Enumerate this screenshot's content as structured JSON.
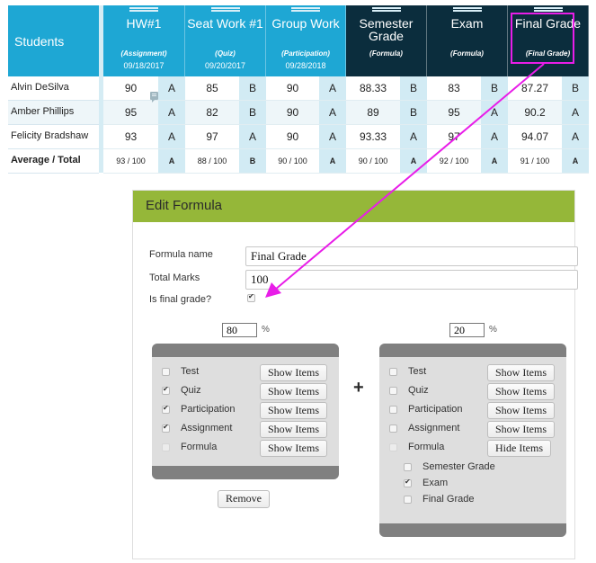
{
  "gradebook": {
    "students_header": "Students",
    "columns": [
      {
        "title": "HW#1",
        "category": "(Assignment)",
        "date": "09/18/2017"
      },
      {
        "title": "Seat Work #1",
        "category": "(Quiz)",
        "date": "09/20/2017"
      },
      {
        "title": "Group Work",
        "category": "(Participation)",
        "date": "09/28/2018"
      },
      {
        "title": "Semester Grade",
        "category": "(Formula)",
        "date": ""
      },
      {
        "title": "Exam",
        "category": "(Formula)",
        "date": ""
      },
      {
        "title": "Final Grade",
        "category": "(Final Grade)",
        "date": ""
      }
    ],
    "rows": [
      {
        "student": "Alvin DeSilva",
        "values": [
          "90",
          "85",
          "90",
          "88.33",
          "83",
          "87.27"
        ],
        "letters": [
          "A",
          "B",
          "A",
          "B",
          "B",
          "B"
        ]
      },
      {
        "student": "Amber Phillips",
        "values": [
          "95",
          "82",
          "90",
          "89",
          "95",
          "90.2"
        ],
        "letters": [
          "A",
          "B",
          "A",
          "B",
          "A",
          "A"
        ]
      },
      {
        "student": "Felicity Bradshaw",
        "values": [
          "93",
          "97",
          "90",
          "93.33",
          "97",
          "94.07"
        ],
        "letters": [
          "A",
          "A",
          "A",
          "A",
          "A",
          "A"
        ]
      }
    ],
    "total": {
      "label": "Average / Total",
      "values": [
        "93 / 100",
        "88 / 100",
        "90 / 100",
        "90 / 100",
        "92 / 100",
        "91 / 100"
      ],
      "letters": [
        "A",
        "B",
        "A",
        "A",
        "A",
        "A"
      ]
    }
  },
  "dialog": {
    "title": "Edit Formula",
    "formula_name_label": "Formula name",
    "formula_name_value": "Final Grade",
    "total_marks_label": "Total Marks",
    "total_marks_value": "100",
    "is_final_label": "Is final grade?",
    "is_final_checked": true,
    "plus": "+",
    "percent_sign": "%",
    "remove_label": "Remove",
    "groups": [
      {
        "percent": "80",
        "items": [
          {
            "label": "Test",
            "checked": false,
            "button": "Show Items"
          },
          {
            "label": "Quiz",
            "checked": true,
            "button": "Show Items"
          },
          {
            "label": "Participation",
            "checked": true,
            "button": "Show Items"
          },
          {
            "label": "Assignment",
            "checked": true,
            "button": "Show Items"
          },
          {
            "label": "Formula",
            "checked": false,
            "disabled": true,
            "button": "Show Items"
          }
        ],
        "sub_items": []
      },
      {
        "percent": "20",
        "items": [
          {
            "label": "Test",
            "checked": false,
            "button": "Show Items"
          },
          {
            "label": "Quiz",
            "checked": false,
            "button": "Show Items"
          },
          {
            "label": "Participation",
            "checked": false,
            "button": "Show Items"
          },
          {
            "label": "Assignment",
            "checked": false,
            "button": "Show Items"
          },
          {
            "label": "Formula",
            "checked": false,
            "disabled": true,
            "button": "Hide Items"
          }
        ],
        "sub_items": [
          {
            "label": "Semester Grade",
            "checked": false
          },
          {
            "label": "Exam",
            "checked": true
          },
          {
            "label": "Final Grade",
            "checked": false
          }
        ]
      }
    ]
  },
  "annotation": {
    "color": "#e81de8"
  }
}
